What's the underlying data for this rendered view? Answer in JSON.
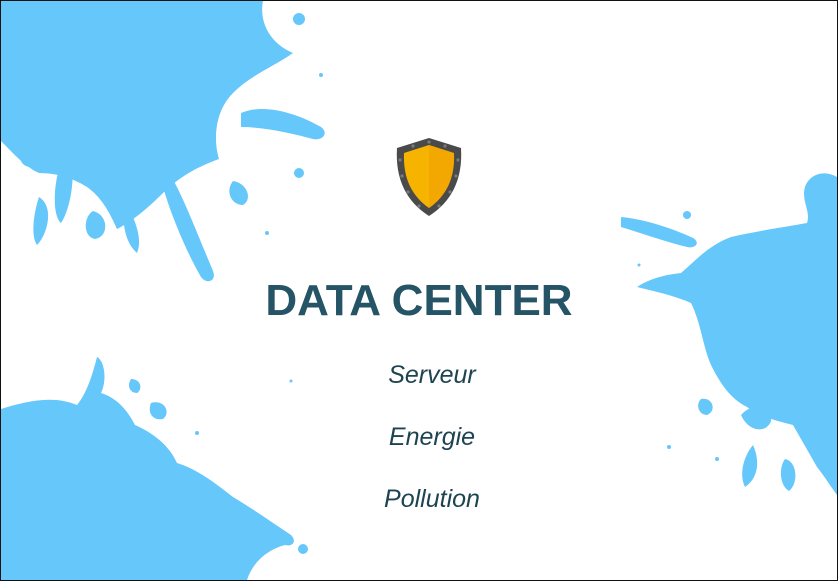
{
  "slide": {
    "title": "DATA CENTER",
    "items": [
      "Serveur",
      "Energie",
      "Pollution"
    ]
  },
  "colors": {
    "splash": "#66c7fa",
    "title": "#245465",
    "text": "#1e4452",
    "shield_fill": "#f6b400",
    "shield_border": "#4a4a4a"
  },
  "icons": {
    "emblem": "shield-icon"
  }
}
